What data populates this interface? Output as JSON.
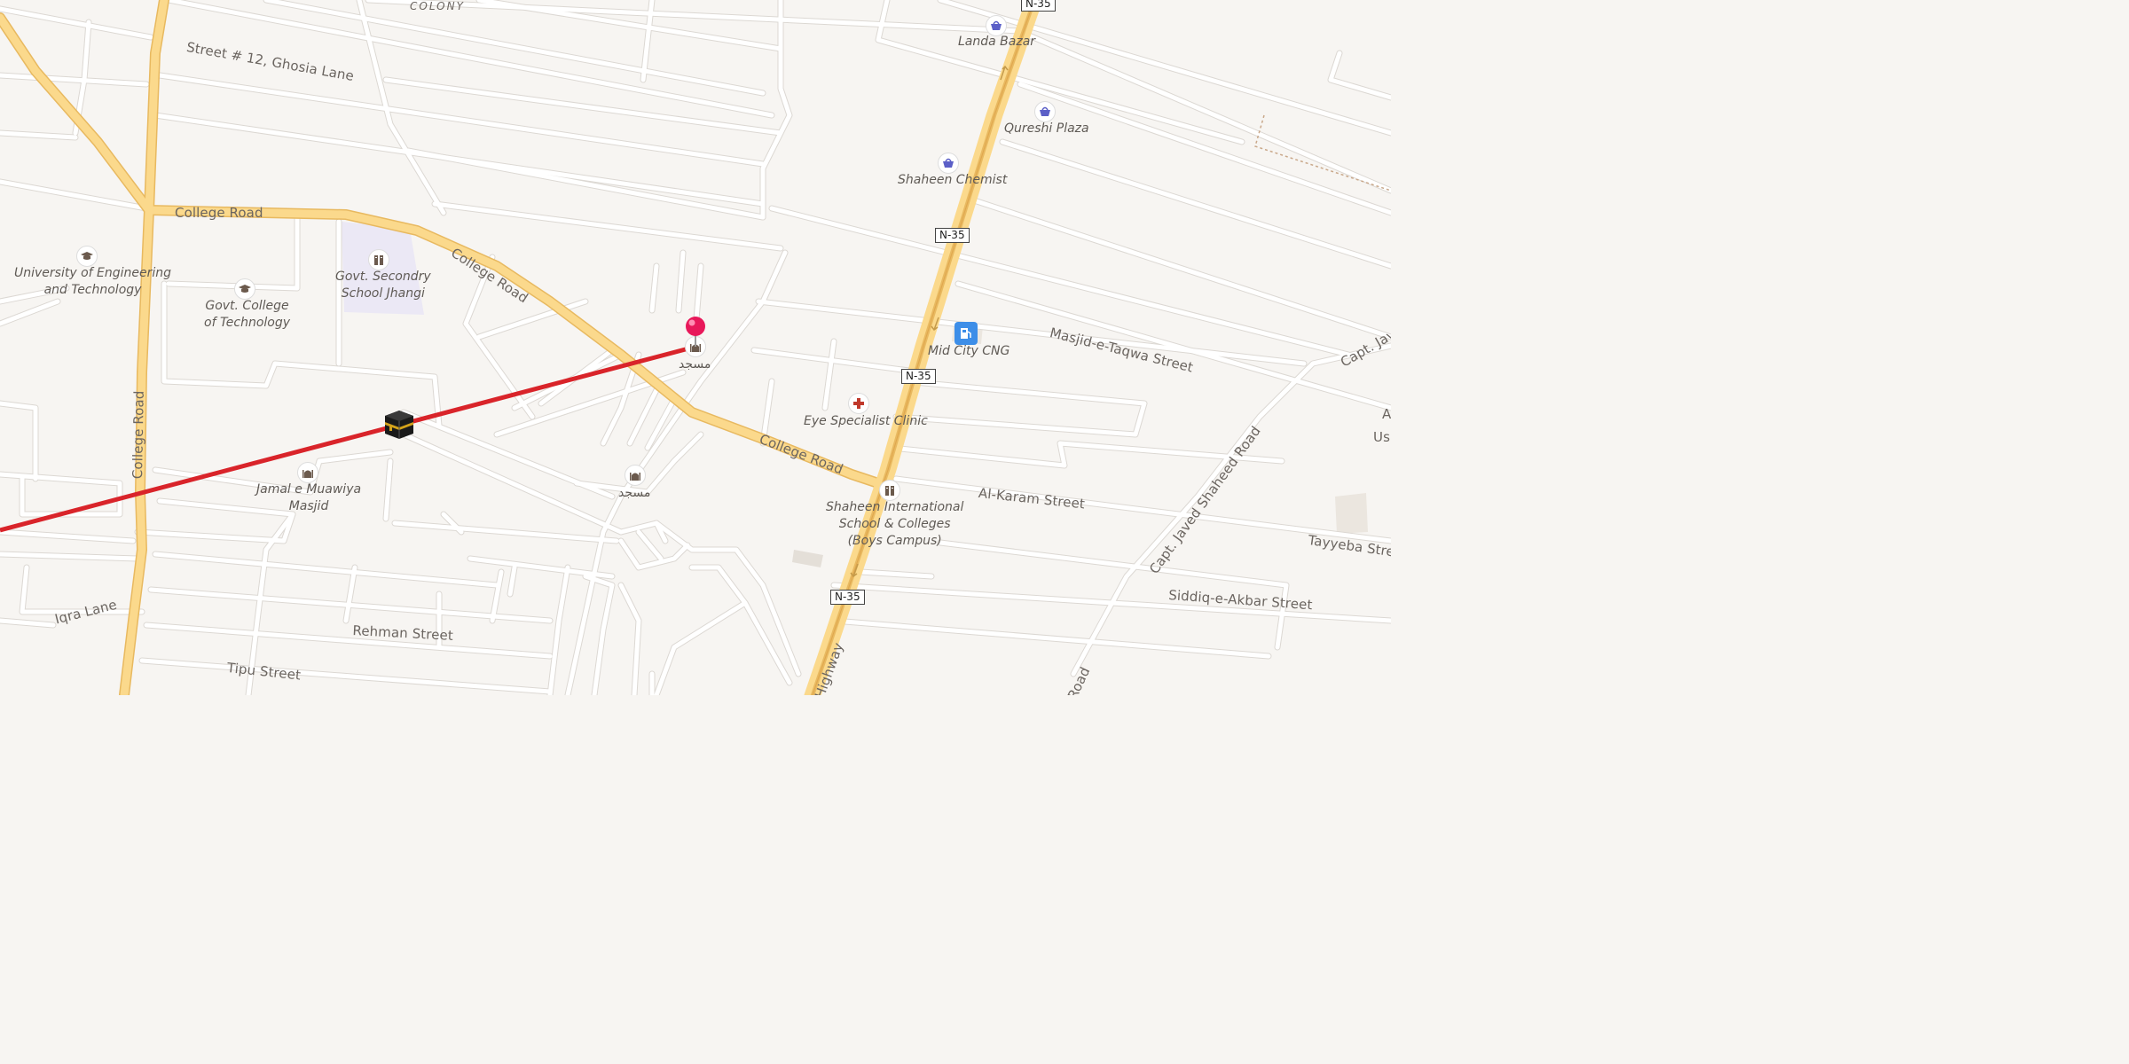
{
  "colors": {
    "background": "#f7f5f2",
    "minor_road": "#ffffff",
    "minor_road_edge": "#dcd8d3",
    "major_road": "#fbd98c",
    "major_road_edge": "#e8b960",
    "route_line": "#d9242a",
    "pin": "#e8185a",
    "school_area": "#ebe8f5",
    "shop_icon": "#5b5fc7",
    "clinic_icon": "#c0392b",
    "fuel_icon": "#3d8ee8"
  },
  "districts": {
    "colony": "COLONY"
  },
  "roads": {
    "street_12": "Street # 12, Ghosia Lane",
    "college_road_1": "College Road",
    "college_road_2": "College Road",
    "college_road_3": "College Road",
    "college_road_vertical": "College Road",
    "masjid_taqwa": "Masjid-e-Taqwa Street",
    "al_karam": "Al-Karam Street",
    "tayyeba": "Tayyeba Stre",
    "siddiq": "Siddiq-e-Akbar Street",
    "capt_javed": "Capt. Javed Shaheed Road",
    "capt_jave_edge": "Capt. Jave",
    "us_edge": "Us",
    "a_edge": "A",
    "iqra": "Iqra Lane",
    "rehman": "Rehman Street",
    "tipu": "Tipu Street",
    "highway": "Highway",
    "road_edge": "Road"
  },
  "shields": [
    "N-35",
    "N-35",
    "N-35",
    "N-35"
  ],
  "pois": {
    "landa_bazar": {
      "label": "Landa Bazar",
      "icon": "shopping-basket-icon"
    },
    "qureshi_plaza": {
      "label": "Qureshi Plaza",
      "icon": "shopping-basket-icon"
    },
    "shaheen_chemist": {
      "label": "Shaheen Chemist",
      "icon": "shopping-basket-icon"
    },
    "mid_city_cng": {
      "label": "Mid City CNG",
      "icon": "fuel-pump-icon"
    },
    "eye_clinic": {
      "label": "Eye Specialist Clinic",
      "icon": "medical-cross-icon"
    },
    "uet": {
      "line1": "University of Engineering",
      "line2": "and Technology",
      "icon": "graduation-cap-icon"
    },
    "govt_college": {
      "line1": "Govt. College",
      "line2": "of Technology",
      "icon": "graduation-cap-icon"
    },
    "govt_school": {
      "line1": "Govt. Secondry",
      "line2": "School Jhangi",
      "icon": "school-icon"
    },
    "jamal_masjid": {
      "line1": "Jamal e Muawiya",
      "line2": "Masjid",
      "icon": "mosque-icon"
    },
    "masjid_1": {
      "label": "مسجد",
      "icon": "mosque-icon"
    },
    "masjid_2": {
      "label": "مسجد",
      "icon": "mosque-icon"
    },
    "shaheen_school": {
      "line1": "Shaheen International",
      "line2": "School & Colleges",
      "line3": "(Boys Campus)",
      "icon": "school-icon"
    }
  },
  "markers": {
    "location_pin": "location-pin-icon",
    "kaaba": "kaaba-icon",
    "route": "qibla-direction-line"
  }
}
